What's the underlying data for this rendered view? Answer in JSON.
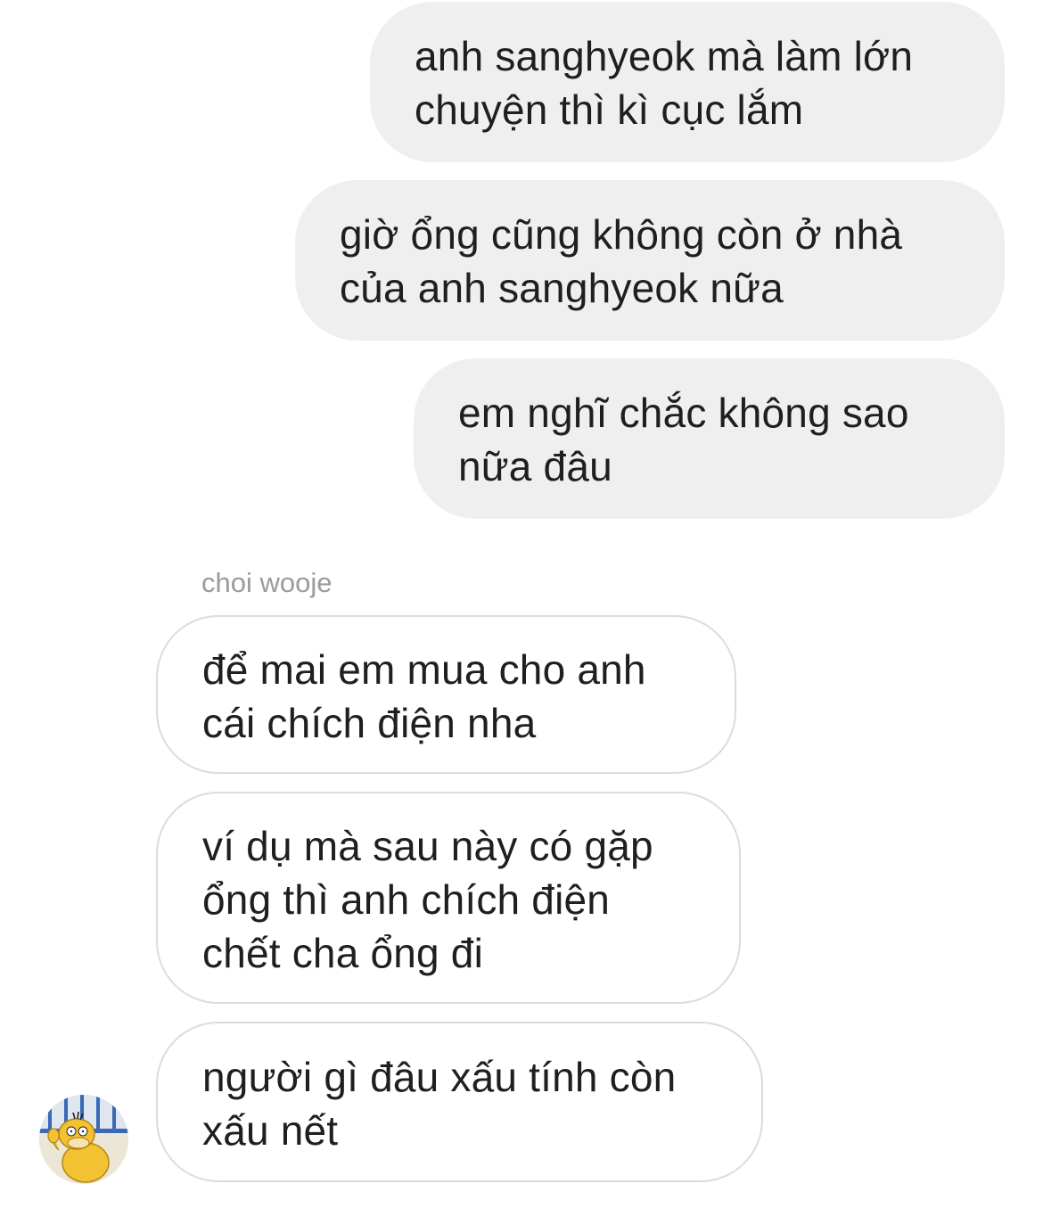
{
  "conversation": {
    "outgoing": [
      {
        "text": "anh sanghyeok mà làm lớn\nchuyện thì kì cục lắm"
      },
      {
        "text": "giờ ổng cũng không còn ở nhà\ncủa anh sanghyeok nữa"
      },
      {
        "text": "em nghĩ chắc không sao\nnữa đâu"
      }
    ],
    "sender_name": "choi wooje",
    "incoming": [
      {
        "text": "để mai em mua cho anh\ncái chích điện nha"
      },
      {
        "text": "ví dụ mà sau này có gặp\nổng thì anh chích điện\nchết cha ổng đi"
      },
      {
        "text": "người gì đâu xấu tính còn\nxấu nết"
      }
    ],
    "avatar_icon": "psyduck-avatar-icon"
  },
  "colors": {
    "outgoing_bubble": "#efefef",
    "incoming_border": "#dcdcdc",
    "sender_name": "#9b9b9b",
    "text": "#1f1f1f"
  }
}
